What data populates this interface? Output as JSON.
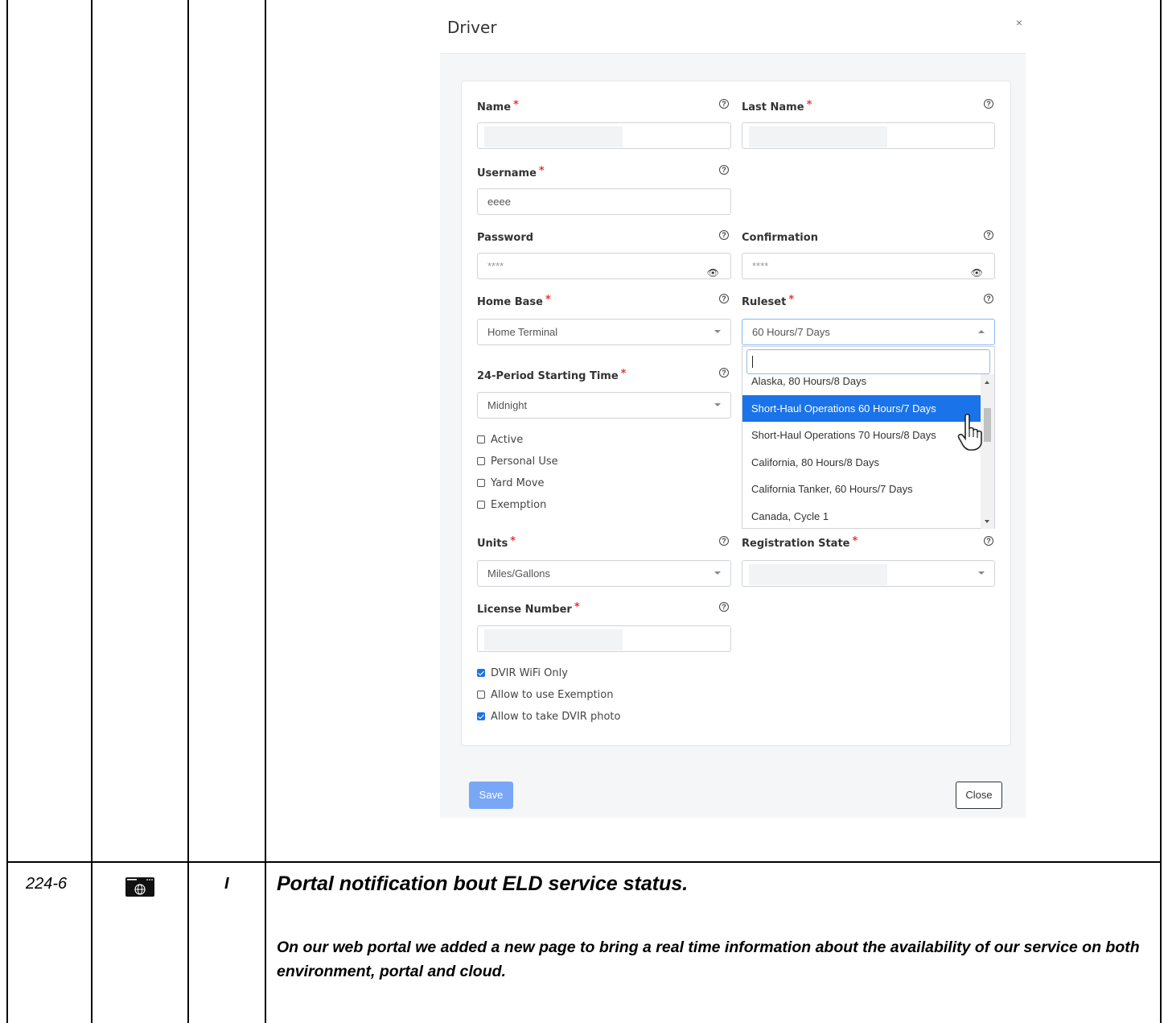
{
  "modal": {
    "title": "Driver",
    "close_symbol": "×",
    "fields": {
      "name_label": "Name",
      "last_name_label": "Last Name",
      "username_label": "Username",
      "username_value": "eeee",
      "password_label": "Password",
      "password_value": "****",
      "confirmation_label": "Confirmation",
      "confirmation_value": "****",
      "home_base_label": "Home Base",
      "home_base_value": "Home Terminal",
      "ruleset_label": "Ruleset",
      "ruleset_value": "60 Hours/7 Days",
      "period_label": "24-Period Starting Time",
      "period_value": "Midnight",
      "units_label": "Units",
      "units_value": "Miles/Gallons",
      "registration_state_label": "Registration State",
      "license_label": "License Number"
    },
    "required_mark": "*",
    "help_symbol": "?",
    "checkboxes_a": [
      {
        "label": "Active",
        "checked": false
      },
      {
        "label": "Personal Use",
        "checked": false
      },
      {
        "label": "Yard Move",
        "checked": false
      },
      {
        "label": "Exemption",
        "checked": false
      }
    ],
    "checkboxes_b": [
      {
        "label": "DVIR WiFi Only",
        "checked": true
      },
      {
        "label": "Allow to use Exemption",
        "checked": false
      },
      {
        "label": "Allow to take DVIR photo",
        "checked": true
      }
    ],
    "ruleset_options": [
      "Alaska, 80 Hours/8 Days",
      "Short-Haul Operations 60 Hours/7 Days",
      "Short-Haul Operations 70 Hours/8 Days",
      "California, 80 Hours/8 Days",
      "California Tanker, 60 Hours/7 Days",
      "Canada, Cycle 1"
    ],
    "ruleset_selected_index": 1,
    "save_label": "Save",
    "close_label": "Close"
  },
  "row": {
    "id": "224-6",
    "type": "I",
    "title": "Portal notification bout ELD service status.",
    "description": "On our web portal we added a new page to bring a real time information about the availability of our service on both environment, portal and cloud."
  },
  "icons": {
    "help": "help-circle-icon",
    "eye": "eye-slash-icon",
    "browser": "web-browser-globe-icon"
  }
}
